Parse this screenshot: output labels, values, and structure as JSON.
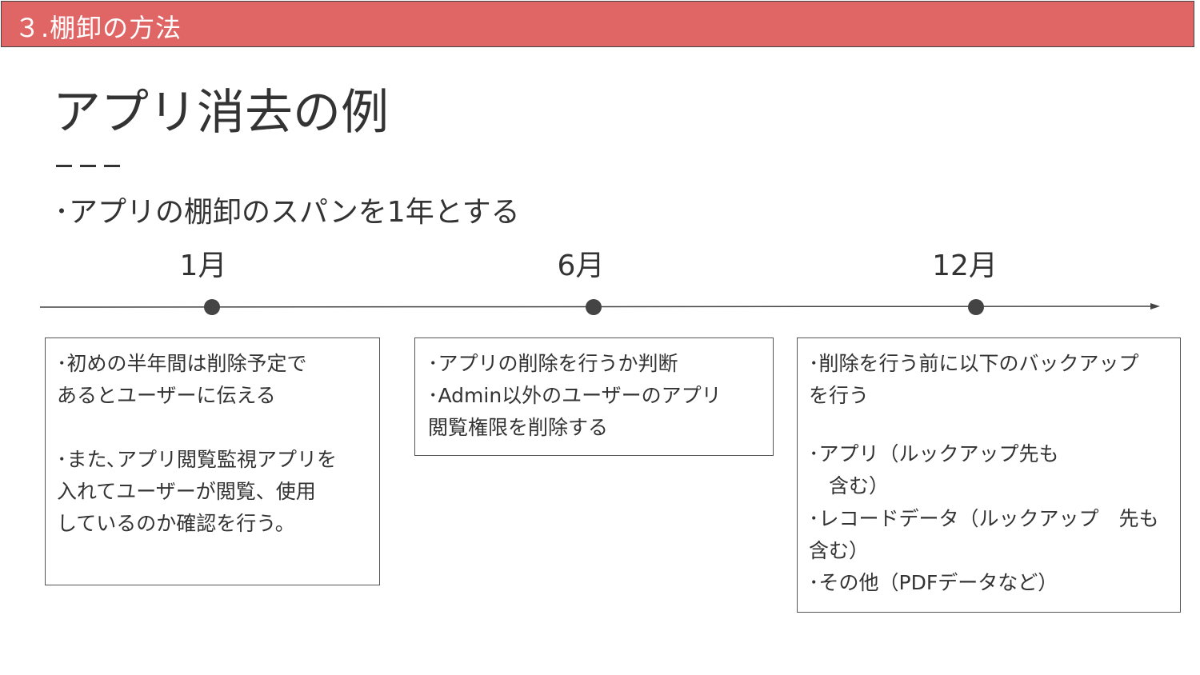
{
  "header": {
    "title": "３.棚卸の方法"
  },
  "slide": {
    "title": "アプリ消去の例",
    "subtitle": "･アプリの棚卸のスパンを1年とする"
  },
  "timeline": {
    "months": [
      "1月",
      "6月",
      "12月"
    ]
  },
  "boxes": {
    "jan": {
      "lines": [
        "･初めの半年間は削除予定で",
        "あるとユーザーに伝える",
        "",
        "･また､アプリ閲覧監視アプリを",
        "入れてユーザーが閲覧、使用",
        "しているのか確認を行う。"
      ]
    },
    "jun": {
      "lines": [
        "･アプリの削除を行うか判断",
        "･Admin以外のユーザーのアプリ",
        "閲覧権限を削除する"
      ]
    },
    "dec": {
      "lines": [
        "･削除を行う前に以下のバックアップ",
        "を行う",
        "･アプリ（ルックアップ先も",
        "　含む）",
        "･レコードデータ（ルックアップ　先も",
        "含む）",
        "･その他（PDFデータなど）"
      ]
    }
  },
  "colors": {
    "header_bg": "#e06666",
    "header_text": "#ffffff",
    "text": "#333333",
    "timeline": "#444444"
  }
}
